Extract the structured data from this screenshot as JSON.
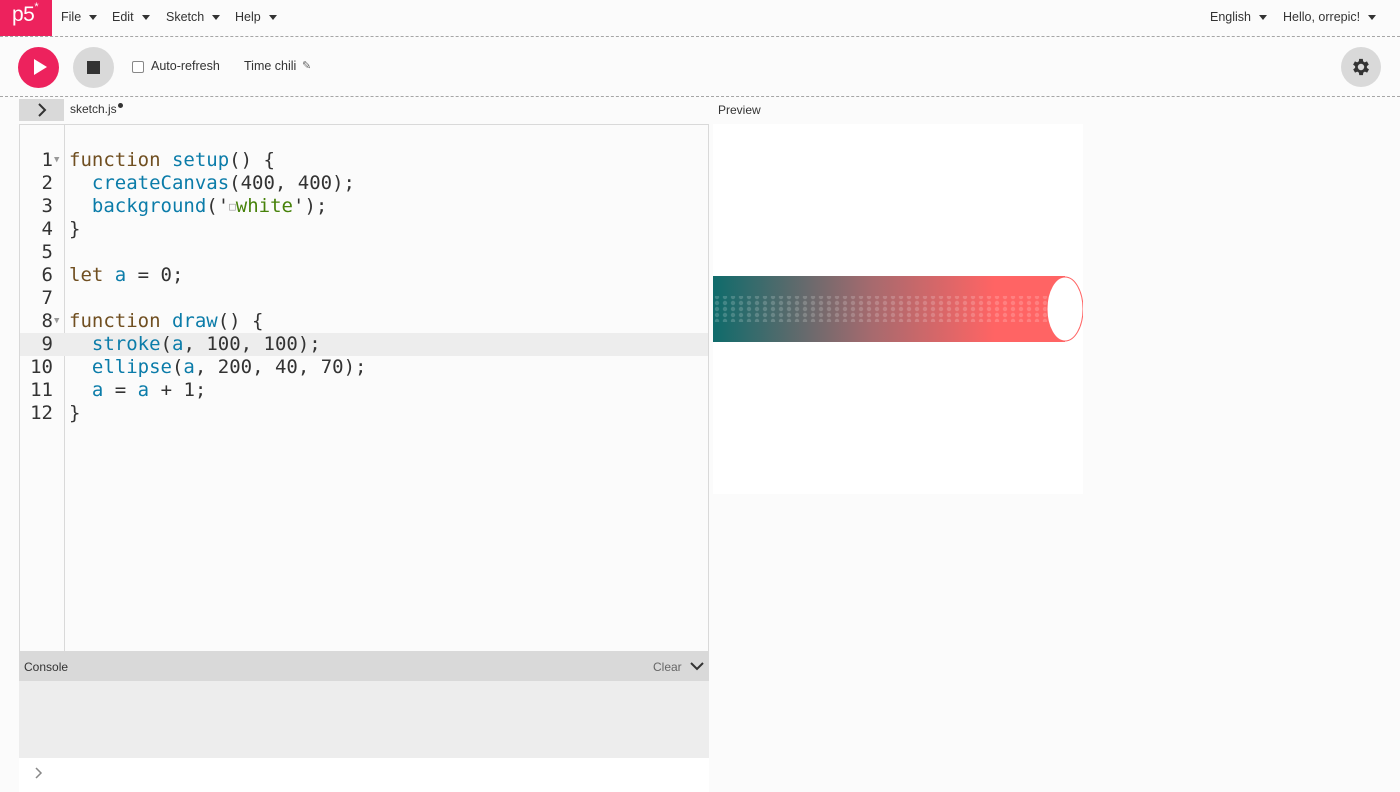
{
  "nav": {
    "logo": "p5",
    "logo_sup": "*",
    "menus": [
      "File",
      "Edit",
      "Sketch",
      "Help"
    ],
    "language": "English",
    "user": "Hello, orrepic!"
  },
  "toolbar": {
    "auto_refresh_label": "Auto-refresh",
    "auto_refresh_checked": false,
    "sketch_name": "Time chili"
  },
  "editor": {
    "file_tab": "sketch.js",
    "active_line": 9,
    "lines": [
      [
        {
          "t": "function",
          "c": "kw"
        },
        {
          "t": " "
        },
        {
          "t": "setup",
          "c": "fn"
        },
        {
          "t": "() {"
        }
      ],
      [
        {
          "t": "  "
        },
        {
          "t": "createCanvas",
          "c": "fn"
        },
        {
          "t": "(400, 400);"
        }
      ],
      [
        {
          "t": "  "
        },
        {
          "t": "background",
          "c": "fn"
        },
        {
          "t": "('"
        },
        {
          "t": "□",
          "c": "swatch"
        },
        {
          "t": "white",
          "c": "str"
        },
        {
          "t": "');"
        }
      ],
      [
        {
          "t": "}"
        }
      ],
      [],
      [
        {
          "t": "let",
          "c": "kw"
        },
        {
          "t": " "
        },
        {
          "t": "a",
          "c": "var"
        },
        {
          "t": " = 0;"
        }
      ],
      [],
      [
        {
          "t": "function",
          "c": "kw"
        },
        {
          "t": " "
        },
        {
          "t": "draw",
          "c": "fn"
        },
        {
          "t": "() {"
        }
      ],
      [
        {
          "t": "  "
        },
        {
          "t": "stroke",
          "c": "fn"
        },
        {
          "t": "("
        },
        {
          "t": "a",
          "c": "var"
        },
        {
          "t": ", 100, 100);"
        }
      ],
      [
        {
          "t": "  "
        },
        {
          "t": "ellipse",
          "c": "fn"
        },
        {
          "t": "("
        },
        {
          "t": "a",
          "c": "var"
        },
        {
          "t": ", 200, 40, 70);"
        }
      ],
      [
        {
          "t": "  "
        },
        {
          "t": "a",
          "c": "var"
        },
        {
          "t": " = "
        },
        {
          "t": "a",
          "c": "var"
        },
        {
          "t": " + 1;"
        }
      ],
      [
        {
          "t": "}"
        }
      ]
    ],
    "foldable_lines": [
      1,
      8
    ]
  },
  "preview": {
    "label": "Preview"
  },
  "console": {
    "title": "Console",
    "clear_label": "Clear"
  },
  "colors": {
    "accent": "#ed225d",
    "gradient_start": "#0f6b6b",
    "gradient_end": "#ff6464"
  }
}
